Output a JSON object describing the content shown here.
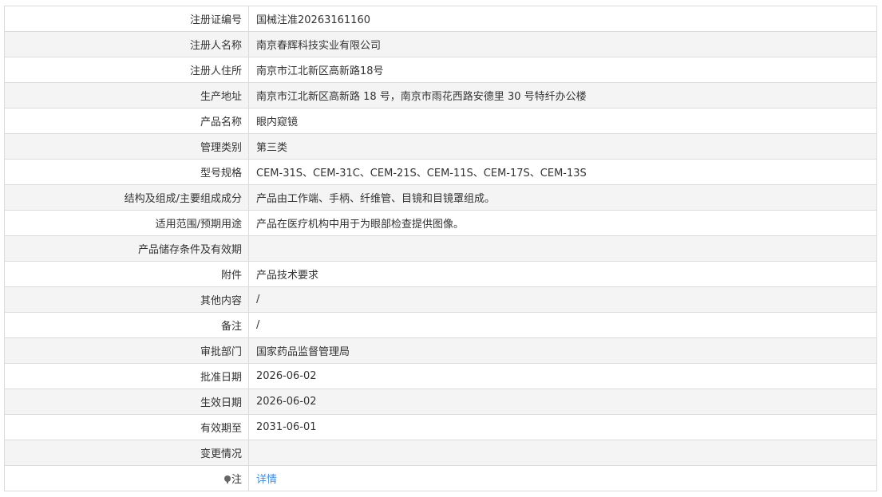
{
  "rows": [
    {
      "label": "注册证编号",
      "value": "国械注准20263161160"
    },
    {
      "label": "注册人名称",
      "value": "南京春辉科技实业有限公司"
    },
    {
      "label": "注册人住所",
      "value": "南京市江北新区高新路18号"
    },
    {
      "label": "生产地址",
      "value": "南京市江北新区高新路 18 号，南京市雨花西路安德里 30 号特纤办公楼"
    },
    {
      "label": "产品名称",
      "value": "眼内窥镜"
    },
    {
      "label": "管理类别",
      "value": "第三类"
    },
    {
      "label": "型号规格",
      "value": "CEM-31S、CEM-31C、CEM-21S、CEM-11S、CEM-17S、CEM-13S"
    },
    {
      "label": "结构及组成/主要组成成分",
      "value": "产品由工作端、手柄、纤维管、目镜和目镜罩组成。"
    },
    {
      "label": "适用范围/预期用途",
      "value": "产品在医疗机构中用于为眼部检查提供图像。"
    },
    {
      "label": "产品储存条件及有效期",
      "value": ""
    },
    {
      "label": "附件",
      "value": "产品技术要求"
    },
    {
      "label": "其他内容",
      "value": "/"
    },
    {
      "label": "备注",
      "value": "/"
    },
    {
      "label": "审批部门",
      "value": "国家药品监督管理局"
    },
    {
      "label": "批准日期",
      "value": "2026-06-02"
    },
    {
      "label": "生效日期",
      "value": "2026-06-02"
    },
    {
      "label": "有效期至",
      "value": "2031-06-01"
    },
    {
      "label": "变更情况",
      "value": ""
    }
  ],
  "note_row": {
    "icon": "lightbulb-icon",
    "label": "注",
    "link_text": "详情"
  },
  "colors": {
    "border": "#dcdcdc",
    "row_alt": "#f4f4f4",
    "text": "#333333",
    "link": "#3a8ee6"
  }
}
